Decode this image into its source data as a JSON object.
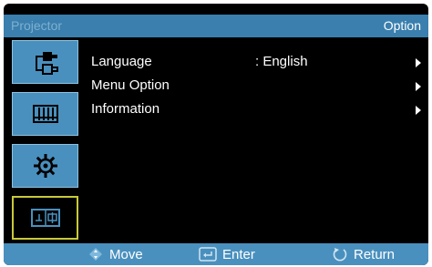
{
  "titlebar": {
    "left": "Projector",
    "right": "Option"
  },
  "sidebar": {
    "items": [
      {
        "icon": "input-source-icon",
        "active": false
      },
      {
        "icon": "picture-icon",
        "active": false
      },
      {
        "icon": "setup-gear-icon",
        "active": false
      },
      {
        "icon": "option-icon",
        "active": true
      }
    ]
  },
  "menu": {
    "items": [
      {
        "label": "Language",
        "value": ": English"
      },
      {
        "label": "Menu Option",
        "value": ""
      },
      {
        "label": "Information",
        "value": ""
      }
    ]
  },
  "footer": {
    "move": "Move",
    "enter": "Enter",
    "return": "Return"
  },
  "colors": {
    "accent_blue": "#3a7fae",
    "sidebar_blue": "#4a90be",
    "active_border": "#c9c93a",
    "background": "#000000"
  }
}
